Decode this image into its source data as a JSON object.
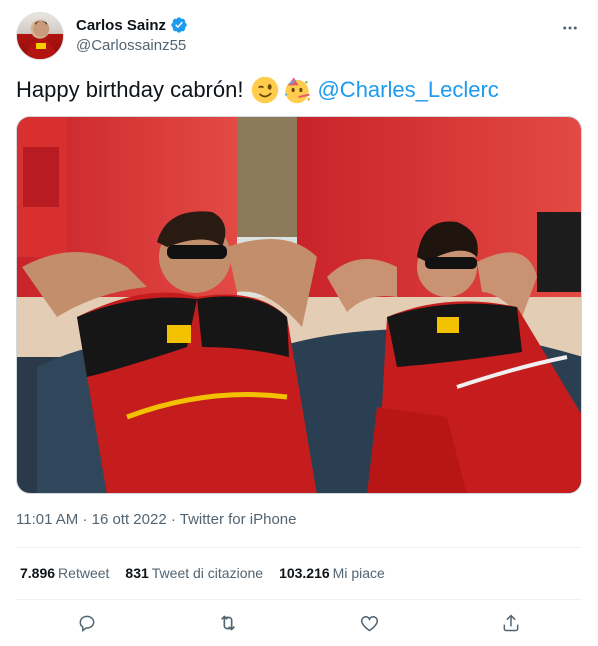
{
  "author": {
    "display_name": "Carlos Sainz",
    "handle": "@Carlossainz55",
    "verified_icon": "verified-badge-icon",
    "avatar_icon": "avatar"
  },
  "tweet": {
    "text": "Happy birthday cabrón!",
    "emojis": [
      "winking-face-emoji",
      "partying-face-emoji"
    ],
    "mention": "@Charles_Leclerc"
  },
  "media": {
    "description_icon": "photo-two-drivers-in-red-team-shirts"
  },
  "meta": {
    "time": "11:01 AM",
    "date": "16 ott 2022",
    "separator": "·",
    "client": "Twitter for iPhone"
  },
  "stats": [
    {
      "value": "7.896",
      "label": "Retweet"
    },
    {
      "value": "831",
      "label": "Tweet di citazione"
    },
    {
      "value": "103.216",
      "label": "Mi piace"
    }
  ],
  "actions": [
    "reply-icon",
    "retweet-icon",
    "like-icon",
    "share-icon"
  ],
  "colors": {
    "text": "#0f1419",
    "secondary": "#536471",
    "link": "#1d9bf0",
    "verified": "#1d9bf0",
    "divider": "#eff3f4"
  }
}
